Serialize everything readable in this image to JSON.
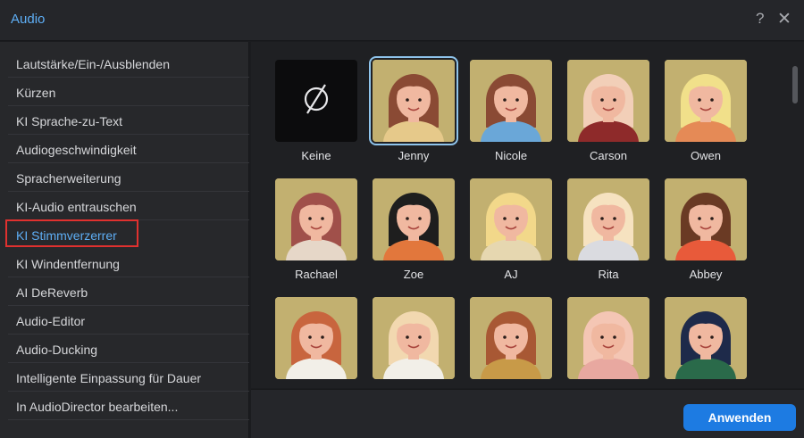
{
  "window": {
    "title": "Audio",
    "help_glyph": "?",
    "close_glyph": "✕"
  },
  "sidebar": {
    "items": [
      {
        "label": "Lautstärke/Ein-/Ausblenden"
      },
      {
        "label": "Kürzen"
      },
      {
        "label": "KI Sprache-zu-Text"
      },
      {
        "label": "Audiogeschwindigkeit"
      },
      {
        "label": "Spracherweiterung"
      },
      {
        "label": "KI-Audio entrauschen"
      },
      {
        "label": "KI Stimmverzerrer",
        "active": true
      },
      {
        "label": "KI Windentfernung"
      },
      {
        "label": "AI DeReverb"
      },
      {
        "label": "Audio-Editor"
      },
      {
        "label": "Audio-Ducking"
      },
      {
        "label": "Intelligente Einpassung für Dauer"
      },
      {
        "label": "In AudioDirector bearbeiten..."
      }
    ]
  },
  "voices": {
    "selected": "Jenny",
    "items": [
      {
        "name": "Keine",
        "icon": "none-icon"
      },
      {
        "name": "Jenny",
        "hair": "#8a4a34",
        "shirt": "#e6c98a"
      },
      {
        "name": "Nicole",
        "hair": "#8a4a34",
        "shirt": "#6aa7d8"
      },
      {
        "name": "Carson",
        "hair": "#f2cfb8",
        "shirt": "#8e2a2a"
      },
      {
        "name": "Owen",
        "hair": "#f1e08a",
        "shirt": "#e58a56"
      },
      {
        "name": "Rachael",
        "hair": "#a0504a",
        "shirt": "#e6d7c8"
      },
      {
        "name": "Zoe",
        "hair": "#1e1e1e",
        "shirt": "#e2773c"
      },
      {
        "name": "AJ",
        "hair": "#f2d88a",
        "shirt": "#e6d7b0"
      },
      {
        "name": "Rita",
        "hair": "#f6e2c0",
        "shirt": "#dadbe0"
      },
      {
        "name": "Abbey",
        "hair": "#6a3a24",
        "shirt": "#e85a3a"
      },
      {
        "name": "",
        "hair": "#c8653e",
        "shirt": "#f2efe8"
      },
      {
        "name": "",
        "hair": "#f2d8b0",
        "shirt": "#f2efe8"
      },
      {
        "name": "",
        "hair": "#a85834",
        "shirt": "#c89a48"
      },
      {
        "name": "",
        "hair": "#f4c6b4",
        "shirt": "#e8a8a0"
      },
      {
        "name": "",
        "hair": "#1e2a4a",
        "shirt": "#2a6a4a"
      }
    ]
  },
  "footer": {
    "apply_label": "Anwenden"
  },
  "colors": {
    "accent": "#1d7be2",
    "title": "#5eaef5",
    "tile_bg": "#c2b070",
    "highlight": "#e0312f"
  }
}
